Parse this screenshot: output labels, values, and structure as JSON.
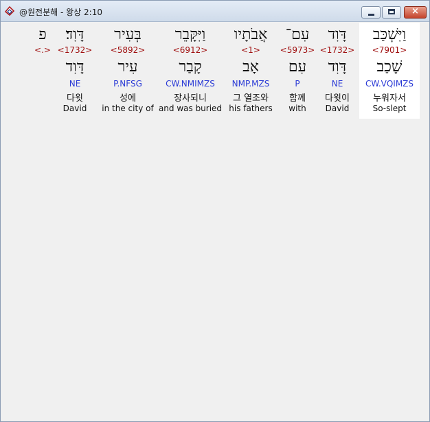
{
  "window": {
    "title": "@원전분해 - 왕상 2:10",
    "icon": "bible-app-icon",
    "controls": {
      "minimize": "minimize-icon",
      "maximize": "maximize-icon",
      "close": "×"
    }
  },
  "words": [
    {
      "hebrew": "וַיִּשְׁכַּב",
      "strong": "<7901>",
      "lemma": "שָׁכַב",
      "parse": "CW.VQIMZS",
      "korean": "누워자서",
      "english": "So-slept",
      "selected": true
    },
    {
      "hebrew": "דָּוִד",
      "strong": "<1732>",
      "lemma": "דָּוִד",
      "parse": "NE",
      "korean": "다윗이",
      "english": "David"
    },
    {
      "hebrew": "עִם־",
      "strong": "<5973>",
      "lemma": "עִם",
      "parse": "P",
      "korean": "함께",
      "english": "with"
    },
    {
      "hebrew": "אֲבֹתָיו",
      "strong": "<1>",
      "lemma": "אָב",
      "parse": "NMP.MZS",
      "korean": "그 열조와",
      "english": "his fathers"
    },
    {
      "hebrew": "וַיִּקָּבֵר",
      "strong": "<6912>",
      "lemma": "קָבַר",
      "parse": "CW.NMIMZS",
      "korean": "장사되니",
      "english": "and was buried"
    },
    {
      "hebrew": "בְּעִיר",
      "strong": "<5892>",
      "lemma": "עִיר",
      "parse": "P.NFSG",
      "korean": "성에",
      "english": "in the city of"
    },
    {
      "hebrew": "דָּוִד׃",
      "strong": "<1732>",
      "lemma": "דָּוִד",
      "parse": "NE",
      "korean": "다윗",
      "english": "David"
    },
    {
      "hebrew": "פ",
      "strong": "<.>",
      "lemma": "",
      "parse": "",
      "korean": "",
      "english": ""
    }
  ]
}
